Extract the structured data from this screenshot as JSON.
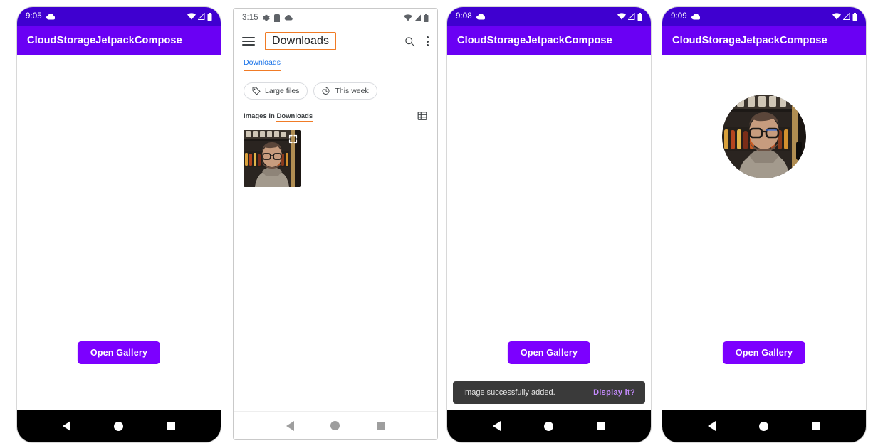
{
  "phones": [
    {
      "id": "phone-1",
      "status": {
        "time": "9:05",
        "left_icons": [
          "cloud-icon"
        ],
        "right_icons": [
          "wifi-icon",
          "signal-icon",
          "battery-icon"
        ]
      },
      "appbar": {
        "title": "CloudStorageJetpackCompose"
      },
      "button": {
        "label": "Open Gallery"
      }
    },
    {
      "id": "phone-2",
      "status": {
        "time": "3:15",
        "left_icons": [
          "gear-icon",
          "sdcard-icon",
          "cloud-icon"
        ],
        "right_icons": [
          "wifi-icon",
          "signal-icon",
          "battery-icon"
        ]
      },
      "picker": {
        "menu_icon": "hamburger-icon",
        "title": "Downloads",
        "search_icon": "search-icon",
        "overflow_icon": "overflow-menu-icon",
        "tab_label": "Downloads",
        "chips": [
          {
            "label": "Large files",
            "icon": "tag-icon"
          },
          {
            "label": "This week",
            "icon": "history-icon"
          }
        ],
        "section_prefix": "Images in ",
        "section_highlight": "Downloads",
        "view_toggle_icon": "list-view-icon",
        "thumbnail": {
          "name": "portrait-thumbnail",
          "expand_icon": "expand-icon"
        }
      }
    },
    {
      "id": "phone-3",
      "status": {
        "time": "9:08",
        "left_icons": [
          "cloud-icon"
        ],
        "right_icons": [
          "wifi-icon",
          "signal-icon",
          "battery-icon"
        ]
      },
      "appbar": {
        "title": "CloudStorageJetpackCompose"
      },
      "button": {
        "label": "Open Gallery"
      },
      "snackbar": {
        "message": "Image successfully added.",
        "action": "Display it?"
      }
    },
    {
      "id": "phone-4",
      "status": {
        "time": "9:09",
        "left_icons": [
          "cloud-icon"
        ],
        "right_icons": [
          "wifi-icon",
          "signal-icon",
          "battery-icon"
        ]
      },
      "appbar": {
        "title": "CloudStorageJetpackCompose"
      },
      "avatar": {
        "name": "profile-avatar"
      },
      "button": {
        "label": "Open Gallery"
      }
    }
  ],
  "navbar": {
    "back_icon": "back-triangle-icon",
    "home_icon": "home-circle-icon",
    "recents_icon": "recents-square-icon"
  },
  "colors": {
    "status_purple": "#3f00d0",
    "appbar_purple": "#6a00f4",
    "button_purple": "#7c00ff",
    "snackbar_bg": "#3a3a3a",
    "snackbar_action": "#c58bff",
    "highlight_orange": "#f07b26",
    "tab_blue": "#1a73e8"
  }
}
